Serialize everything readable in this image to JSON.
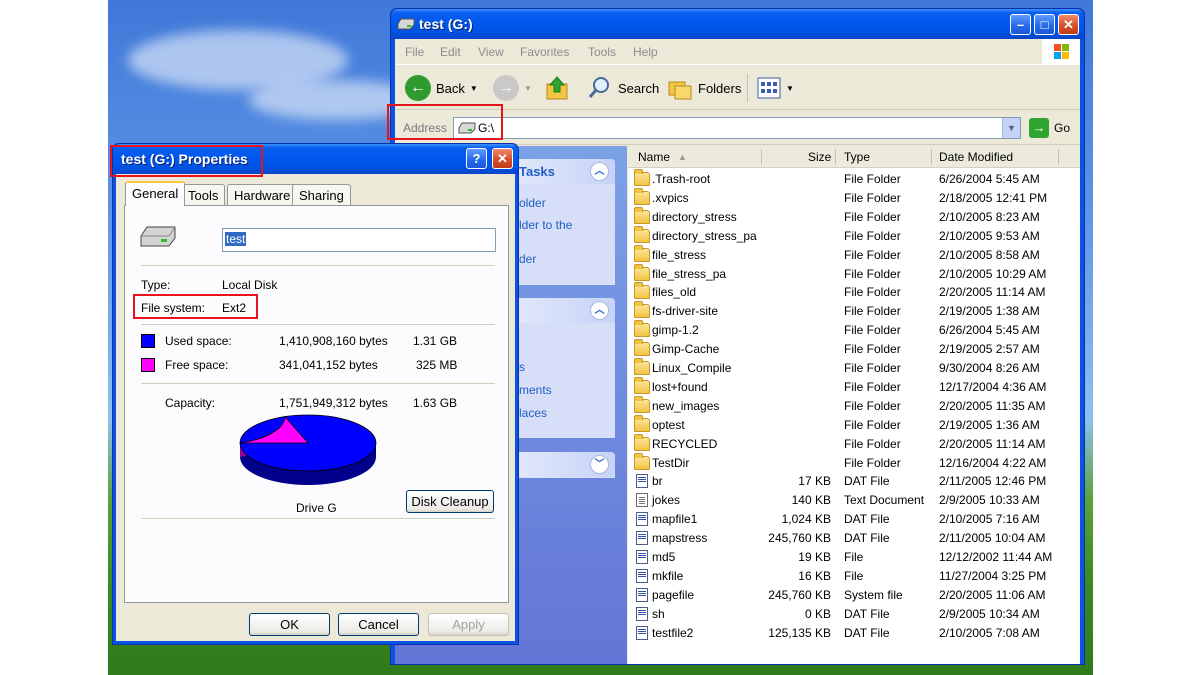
{
  "explorer": {
    "title": "test (G:)",
    "menu": [
      "File",
      "Edit",
      "View",
      "Favorites",
      "Tools",
      "Help"
    ],
    "toolbar": {
      "back": "Back",
      "search": "Search",
      "folders": "Folders"
    },
    "address": {
      "label": "Address",
      "value": "G:\\",
      "go": "Go"
    },
    "taskpane": {
      "block1_title": "Tasks",
      "block1_links": [
        "older",
        "lder to the",
        "der"
      ],
      "block2_links": [
        "s",
        "ments",
        "laces"
      ]
    },
    "columns": {
      "name": "Name",
      "size": "Size",
      "type": "Type",
      "modified": "Date Modified"
    },
    "files": [
      {
        "name": ".Trash-root",
        "size": "",
        "type": "File Folder",
        "modified": "6/26/2004 5:45 AM",
        "icon": "folder-icon"
      },
      {
        "name": ".xvpics",
        "size": "",
        "type": "File Folder",
        "modified": "2/18/2005 12:41 PM",
        "icon": "folder-icon"
      },
      {
        "name": "directory_stress",
        "size": "",
        "type": "File Folder",
        "modified": "2/10/2005 8:23 AM",
        "icon": "folder-icon"
      },
      {
        "name": "directory_stress_pa",
        "size": "",
        "type": "File Folder",
        "modified": "2/10/2005 9:53 AM",
        "icon": "folder-icon"
      },
      {
        "name": "file_stress",
        "size": "",
        "type": "File Folder",
        "modified": "2/10/2005 8:58 AM",
        "icon": "folder-icon"
      },
      {
        "name": "file_stress_pa",
        "size": "",
        "type": "File Folder",
        "modified": "2/10/2005 10:29 AM",
        "icon": "folder-icon"
      },
      {
        "name": "files_old",
        "size": "",
        "type": "File Folder",
        "modified": "2/20/2005 11:14 AM",
        "icon": "folder-icon"
      },
      {
        "name": "fs-driver-site",
        "size": "",
        "type": "File Folder",
        "modified": "2/19/2005 1:38 AM",
        "icon": "folder-icon"
      },
      {
        "name": "gimp-1.2",
        "size": "",
        "type": "File Folder",
        "modified": "6/26/2004 5:45 AM",
        "icon": "folder-icon"
      },
      {
        "name": "Gimp-Cache",
        "size": "",
        "type": "File Folder",
        "modified": "2/19/2005 2:57 AM",
        "icon": "folder-icon"
      },
      {
        "name": "Linux_Compile",
        "size": "",
        "type": "File Folder",
        "modified": "9/30/2004 8:26 AM",
        "icon": "folder-icon"
      },
      {
        "name": "lost+found",
        "size": "",
        "type": "File Folder",
        "modified": "12/17/2004 4:36 AM",
        "icon": "folder-icon"
      },
      {
        "name": "new_images",
        "size": "",
        "type": "File Folder",
        "modified": "2/20/2005 11:35 AM",
        "icon": "folder-icon"
      },
      {
        "name": "optest",
        "size": "",
        "type": "File Folder",
        "modified": "2/19/2005 1:36 AM",
        "icon": "folder-icon"
      },
      {
        "name": "RECYCLED",
        "size": "",
        "type": "File Folder",
        "modified": "2/20/2005 11:14 AM",
        "icon": "folder-icon"
      },
      {
        "name": "TestDir",
        "size": "",
        "type": "File Folder",
        "modified": "12/16/2004 4:22 AM",
        "icon": "folder-icon"
      },
      {
        "name": "br",
        "size": "17 KB",
        "type": "DAT File",
        "modified": "2/11/2005 12:46 PM",
        "icon": "file-icon"
      },
      {
        "name": "jokes",
        "size": "140 KB",
        "type": "Text Document",
        "modified": "2/9/2005 10:33 AM",
        "icon": "text-document-icon"
      },
      {
        "name": "mapfile1",
        "size": "1,024 KB",
        "type": "DAT File",
        "modified": "2/10/2005 7:16 AM",
        "icon": "file-icon"
      },
      {
        "name": "mapstress",
        "size": "245,760 KB",
        "type": "DAT File",
        "modified": "2/11/2005 10:04 AM",
        "icon": "file-icon"
      },
      {
        "name": "md5",
        "size": "19 KB",
        "type": "File",
        "modified": "12/12/2002 11:44 AM",
        "icon": "file-icon"
      },
      {
        "name": "mkfile",
        "size": "16 KB",
        "type": "File",
        "modified": "11/27/2004 3:25 PM",
        "icon": "file-icon"
      },
      {
        "name": "pagefile",
        "size": "245,760 KB",
        "type": "System file",
        "modified": "2/20/2005 11:06 AM",
        "icon": "file-icon"
      },
      {
        "name": "sh",
        "size": "0 KB",
        "type": "DAT File",
        "modified": "2/9/2005 10:34 AM",
        "icon": "file-icon"
      },
      {
        "name": "testfile2",
        "size": "125,135 KB",
        "type": "DAT File",
        "modified": "2/10/2005 7:08 AM",
        "icon": "file-icon"
      }
    ]
  },
  "props": {
    "title": "test (G:) Properties",
    "tabs": [
      "General",
      "Tools",
      "Hardware",
      "Sharing"
    ],
    "label_value": "test",
    "type_label": "Type:",
    "type_value": "Local Disk",
    "fs_label": "File system:",
    "fs_value": "Ext2",
    "used_label": "Used space:",
    "used_bytes": "1,410,908,160 bytes",
    "used_human": "1.31 GB",
    "free_label": "Free space:",
    "free_bytes": "341,041,152 bytes",
    "free_human": "325 MB",
    "cap_label": "Capacity:",
    "cap_bytes": "1,751,949,312 bytes",
    "cap_human": "1.63 GB",
    "drive_caption": "Drive G",
    "disk_cleanup": "Disk Cleanup",
    "ok": "OK",
    "cancel": "Cancel",
    "apply": "Apply",
    "used_fraction": 0.8053,
    "colors": {
      "used": "#0000ff",
      "free": "#ff00ff"
    }
  }
}
